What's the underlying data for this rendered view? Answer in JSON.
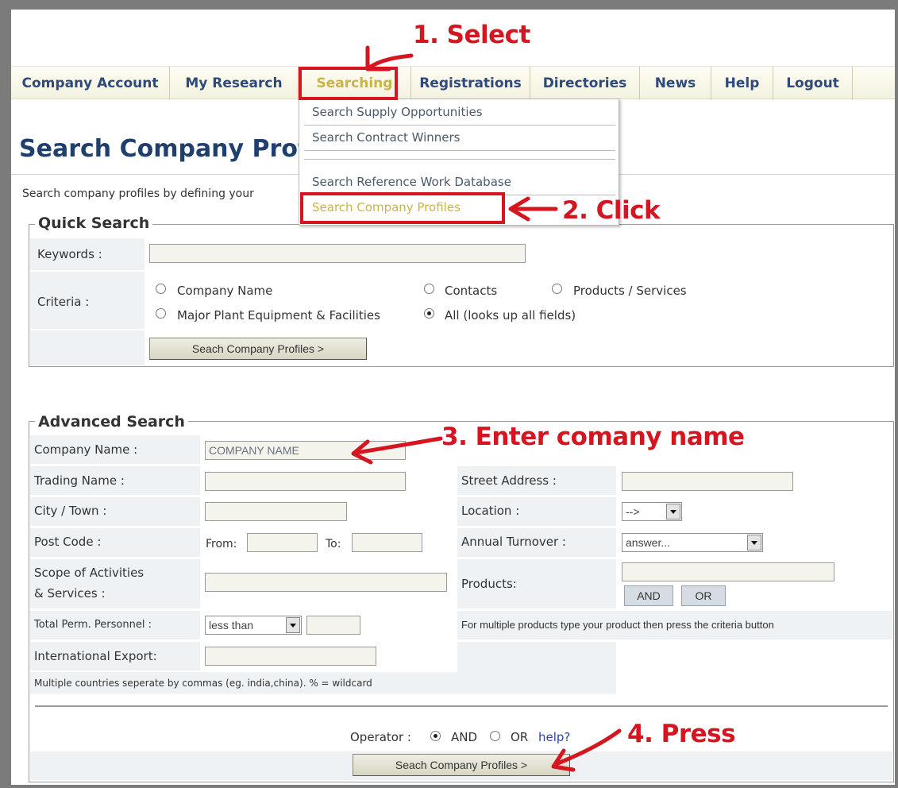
{
  "nav": {
    "items": [
      "Company Account",
      "My Research",
      "Searching",
      "Registrations",
      "Directories",
      "News",
      "Help",
      "Logout"
    ]
  },
  "dropdown": {
    "items": [
      "Search Supply Opportunities",
      "Search Contract Winners",
      "Search Reference Work Database",
      "Search Company Profiles"
    ]
  },
  "annotations": {
    "step1": "1. Select",
    "step2": "2. Click",
    "step3": "3. Enter comany name",
    "step4": "4. Press"
  },
  "page": {
    "title": "Search Company Prof",
    "intro": "Search company profiles by defining your"
  },
  "quick_search": {
    "legend": "Quick Search",
    "keywords_label": "Keywords :",
    "criteria_label": "Criteria :",
    "options": [
      "Company Name",
      "Contacts",
      "Products / Services",
      "Major Plant Equipment & Facilities",
      "All (looks up all fields)"
    ],
    "selected_option": "All (looks up all fields)",
    "button": "Seach Company Profiles >"
  },
  "advanced_search": {
    "legend": "Advanced Search",
    "company_name_label": "Company Name :",
    "company_name_value": "COMPANY NAME",
    "trading_name_label": "Trading Name :",
    "street_address_label": "Street Address :",
    "city_label": "City / Town :",
    "location_label": "Location :",
    "location_value": "-->",
    "post_code_label": "Post Code :",
    "from_label": "From:",
    "to_label": "To:",
    "turnover_label": "Annual Turnover :",
    "turnover_value": "answer...",
    "scope_label_1": "Scope of Activities",
    "scope_label_2": "& Services :",
    "products_label": "Products:",
    "and_button": "AND",
    "or_button": "OR",
    "personnel_label": "Total Perm. Personnel :",
    "personnel_value": "less than",
    "products_hint": "For multiple products type your product then press the criteria button",
    "export_label": "International Export:",
    "export_hint": "Multiple countries seperate by commas (eg. india,china). % = wildcard",
    "operator_label": "Operator :",
    "operator_and": "AND",
    "operator_or": "OR",
    "operator_selected": "AND",
    "help_link": "help?",
    "button": "Seach Company Profiles >"
  },
  "colors": {
    "annotation": "#d51620",
    "nav_text": "#2e4a7a",
    "nav_active": "#c9b34a",
    "title": "#1f3f6e"
  }
}
